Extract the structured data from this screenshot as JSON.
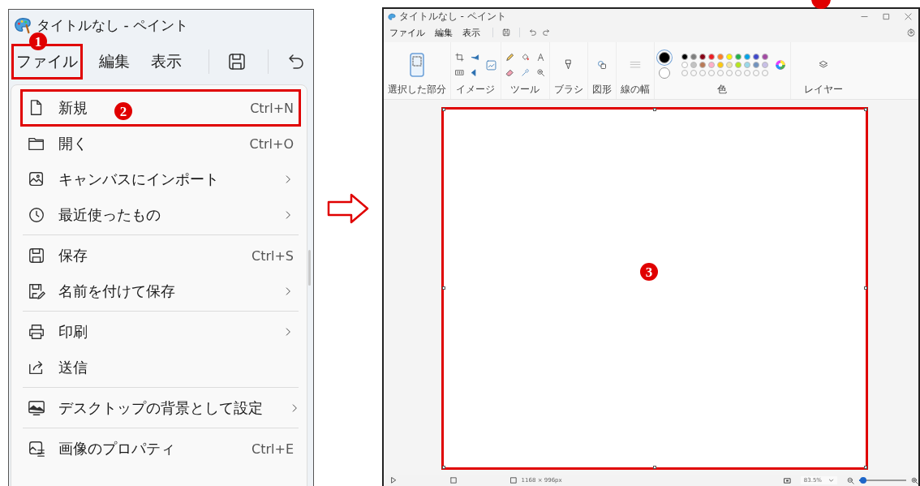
{
  "annotations": [
    {
      "label": "1"
    },
    {
      "label": "2"
    },
    {
      "label": "3"
    }
  ],
  "left_window": {
    "title": "タイトルなし - ペイント",
    "menu_bar": [
      {
        "label": "ファイル",
        "highlighted": true
      },
      {
        "label": "編集",
        "highlighted": false
      },
      {
        "label": "表示",
        "highlighted": false
      }
    ],
    "file_menu": [
      {
        "label": "新規",
        "shortcut": "Ctrl+N",
        "submenu": false,
        "highlighted": true,
        "separator_before": false
      },
      {
        "label": "開く",
        "shortcut": "Ctrl+O",
        "submenu": false,
        "highlighted": false,
        "separator_before": false
      },
      {
        "label": "キャンバスにインポート",
        "submenu": true,
        "highlighted": false,
        "separator_before": false
      },
      {
        "label": "最近使ったもの",
        "submenu": true,
        "highlighted": false,
        "separator_before": false
      },
      {
        "label": "保存",
        "shortcut": "Ctrl+S",
        "submenu": false,
        "highlighted": false,
        "separator_before": true
      },
      {
        "label": "名前を付けて保存",
        "submenu": true,
        "highlighted": false,
        "separator_before": false
      },
      {
        "label": "印刷",
        "submenu": true,
        "highlighted": false,
        "separator_before": true
      },
      {
        "label": "送信",
        "submenu": false,
        "highlighted": false,
        "separator_before": false
      },
      {
        "label": "デスクトップの背景として設定",
        "submenu": true,
        "highlighted": false,
        "separator_before": true
      },
      {
        "label": "画像のプロパティ",
        "shortcut": "Ctrl+E",
        "submenu": false,
        "highlighted": false,
        "separator_before": true
      }
    ]
  },
  "right_window": {
    "title": "タイトルなし - ペイント",
    "menu_bar": [
      "ファイル",
      "編集",
      "表示"
    ],
    "ribbon_groups": [
      "選択した部分",
      "イメージ",
      "ツール",
      "ブラシ",
      "図形",
      "線の幅",
      "色",
      "レイヤー"
    ],
    "current_colors": [
      {
        "color": "#000000",
        "selected": true
      },
      {
        "color": "#ffffff",
        "selected": false
      }
    ],
    "palette": [
      {
        "color": "#000000"
      },
      {
        "color": "#7f7f7f"
      },
      {
        "color": "#880015"
      },
      {
        "color": "#ed1c24"
      },
      {
        "color": "#ff7f27"
      },
      {
        "color": "#fff200"
      },
      {
        "color": "#22b14c"
      },
      {
        "color": "#00a2e8"
      },
      {
        "color": "#3f48cc"
      },
      {
        "color": "#a349a4"
      },
      {
        "color": "#ffffff"
      },
      {
        "color": "#c3c3c3"
      },
      {
        "color": "#b97a57"
      },
      {
        "color": "#ffaec9"
      },
      {
        "color": "#ffc90e"
      },
      {
        "color": "#efe4b0"
      },
      {
        "color": "#b5e61d"
      },
      {
        "color": "#99d9ea"
      },
      {
        "color": "#7092be"
      },
      {
        "color": "#c8bfe7"
      }
    ],
    "canvas": {
      "highlighted": true
    },
    "status_bar": {
      "canvas_size": "1168 × 996px",
      "zoom": "83.5%",
      "zoom_level": {
        "level": 0.08
      }
    }
  }
}
